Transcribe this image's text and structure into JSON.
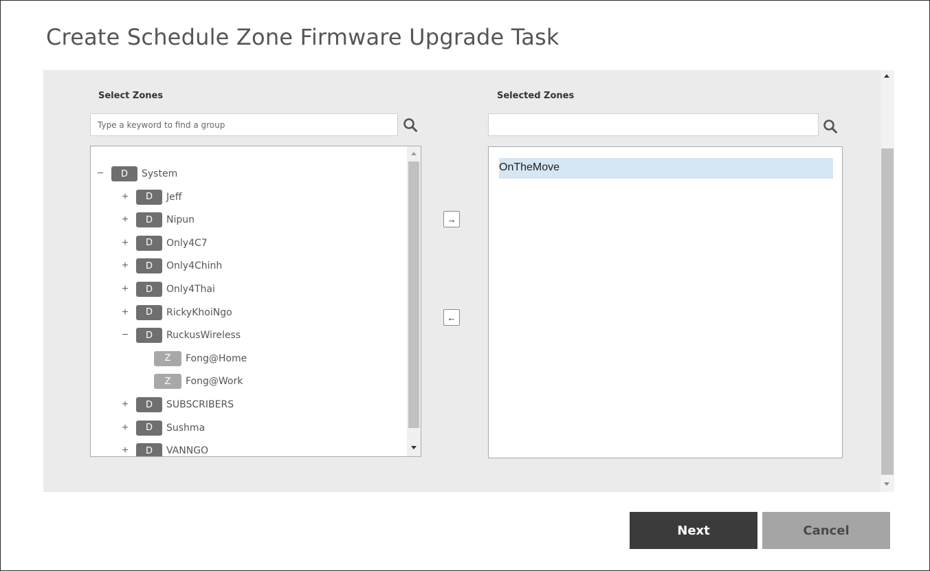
{
  "dialog": {
    "title": "Create Schedule Zone Firmware Upgrade Task"
  },
  "left_panel": {
    "label": "Select Zones",
    "search_placeholder": "Type a keyword to find a group",
    "tree": [
      {
        "toggle": "−",
        "badge": "D",
        "label": "System",
        "level": 0,
        "kind": "domain"
      },
      {
        "toggle": "+",
        "badge": "D",
        "label": "Jeff",
        "level": 1,
        "kind": "domain"
      },
      {
        "toggle": "+",
        "badge": "D",
        "label": "Nipun",
        "level": 1,
        "kind": "domain"
      },
      {
        "toggle": "+",
        "badge": "D",
        "label": "Only4C7",
        "level": 1,
        "kind": "domain"
      },
      {
        "toggle": "+",
        "badge": "D",
        "label": "Only4Chinh",
        "level": 1,
        "kind": "domain"
      },
      {
        "toggle": "+",
        "badge": "D",
        "label": "Only4Thai",
        "level": 1,
        "kind": "domain"
      },
      {
        "toggle": "+",
        "badge": "D",
        "label": "RickyKhoiNgo",
        "level": 1,
        "kind": "domain"
      },
      {
        "toggle": "−",
        "badge": "D",
        "label": "RuckusWireless",
        "level": 1,
        "kind": "domain"
      },
      {
        "toggle": "",
        "badge": "Z",
        "label": "Fong@Home",
        "level": 2,
        "kind": "zone"
      },
      {
        "toggle": "",
        "badge": "Z",
        "label": "Fong@Work",
        "level": 2,
        "kind": "zone"
      },
      {
        "toggle": "+",
        "badge": "D",
        "label": "SUBSCRIBERS",
        "level": 1,
        "kind": "domain"
      },
      {
        "toggle": "+",
        "badge": "D",
        "label": "Sushma",
        "level": 1,
        "kind": "domain"
      },
      {
        "toggle": "+",
        "badge": "D",
        "label": "VANNGO",
        "level": 1,
        "kind": "domain"
      }
    ]
  },
  "transfer": {
    "add_glyph": "→",
    "remove_glyph": "←"
  },
  "right_panel": {
    "label": "Selected Zones",
    "search_value": "",
    "items": [
      "OnTheMove"
    ]
  },
  "actions": {
    "next_label": "Next",
    "cancel_label": "Cancel"
  },
  "icons": {
    "search": "search-icon",
    "add": "arrow-right-icon",
    "remove": "arrow-left-icon"
  }
}
